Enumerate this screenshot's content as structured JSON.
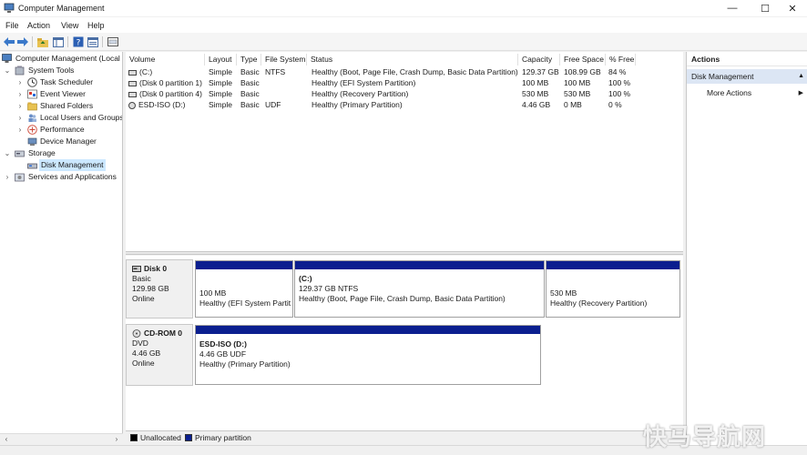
{
  "window": {
    "title": "Computer Management"
  },
  "menu": [
    "File",
    "Action",
    "View",
    "Help"
  ],
  "tree": {
    "root": "Computer Management (Local",
    "system_tools": "System Tools",
    "task_scheduler": "Task Scheduler",
    "event_viewer": "Event Viewer",
    "shared_folders": "Shared Folders",
    "local_users": "Local Users and Groups",
    "performance": "Performance",
    "device_manager": "Device Manager",
    "storage": "Storage",
    "disk_management": "Disk Management",
    "services": "Services and Applications"
  },
  "volume_list": {
    "columns": [
      "Volume",
      "Layout",
      "Type",
      "File System",
      "Status",
      "Capacity",
      "Free Space",
      "% Free"
    ],
    "rows": [
      [
        "(C:)",
        "Simple",
        "Basic",
        "NTFS",
        "Healthy (Boot, Page File, Crash Dump, Basic Data Partition)",
        "129.37 GB",
        "108.99 GB",
        "84 %"
      ],
      [
        "(Disk 0 partition 1)",
        "Simple",
        "Basic",
        "",
        "Healthy (EFI System Partition)",
        "100 MB",
        "100 MB",
        "100 %"
      ],
      [
        "(Disk 0 partition 4)",
        "Simple",
        "Basic",
        "",
        "Healthy (Recovery Partition)",
        "530 MB",
        "530 MB",
        "100 %"
      ],
      [
        "ESD-ISO (D:)",
        "Simple",
        "Basic",
        "UDF",
        "Healthy (Primary Partition)",
        "4.46 GB",
        "0 MB",
        "0 %"
      ]
    ]
  },
  "disks": {
    "disk0": {
      "name": "Disk 0",
      "type": "Basic",
      "size": "129.98 GB",
      "state": "Online",
      "partitions": [
        {
          "title": "",
          "size": "100 MB",
          "status": "Healthy (EFI System Partit"
        },
        {
          "title": "(C:)",
          "size": "129.37 GB NTFS",
          "status": "Healthy (Boot, Page File, Crash Dump, Basic Data Partition)"
        },
        {
          "title": "",
          "size": "530 MB",
          "status": "Healthy (Recovery Partition)"
        }
      ]
    },
    "cdrom0": {
      "name": "CD-ROM 0",
      "type": "DVD",
      "size": "4.46 GB",
      "state": "Online",
      "partitions": [
        {
          "title": "ESD-ISO  (D:)",
          "size": "4.46 GB UDF",
          "status": "Healthy (Primary Partition)"
        }
      ]
    }
  },
  "legend": {
    "unallocated": "Unallocated",
    "primary": "Primary partition",
    "unallocated_color": "#000000",
    "primary_color": "#0b1f8f"
  },
  "actions": {
    "header": "Actions",
    "section": "Disk Management",
    "more": "More Actions"
  },
  "watermark": "快马导航网"
}
